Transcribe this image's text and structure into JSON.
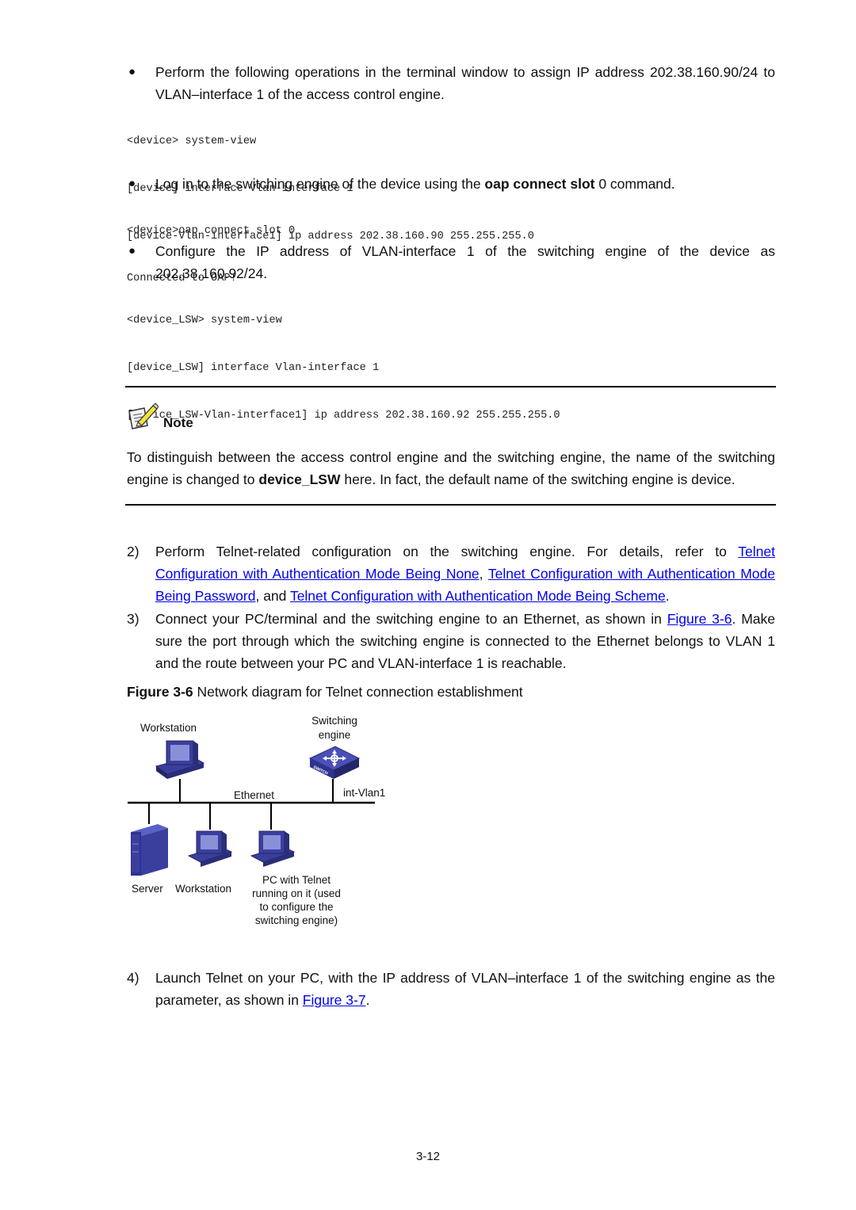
{
  "bullets": [
    {
      "text": "Perform the following operations in the terminal window to assign IP address 202.38.160.90/24 to VLAN–interface 1 of the access control engine."
    },
    {
      "text_before": "Log in to the switching engine of the device using the ",
      "bold": "oap connect slot",
      "text_after": " 0 command."
    },
    {
      "text": "Configure the IP address of VLAN-interface 1 of the switching engine of the device as 202.38.160.92/24."
    }
  ],
  "code_blocks": [
    [
      "<device> system-view",
      "[device] interface Vlan-interface 1",
      "[device-Vlan-interface1] ip address 202.38.160.90 255.255.255.0"
    ],
    [
      "<device>oap connect slot 0",
      "Connected to OAP!"
    ],
    [
      "<device_LSW> system-view",
      "[device_LSW] interface Vlan-interface 1",
      "[device_LSW-Vlan-interface1] ip address 202.38.160.92 255.255.255.0"
    ]
  ],
  "note": {
    "title": "Note",
    "text_before": "To distinguish between the access control engine and the switching engine, the name of the switching engine is changed to ",
    "bold": "device_LSW",
    "text_after": " here. In fact, the default name of the switching engine is device."
  },
  "steps": [
    {
      "number": "2)",
      "text_before": "Perform Telnet-related configuration on the switching engine. For details, refer to ",
      "link1": "Telnet Configuration with Authentication Mode Being None",
      "sep1": ", ",
      "link2": "Telnet Configuration with Authentication Mode Being Password",
      "sep2": ", and ",
      "link3": "Telnet Configuration with Authentication Mode Being Scheme",
      "text_after": "."
    },
    {
      "number": "3)",
      "text_before": "Connect your PC/terminal and the switching engine to an Ethernet, as shown in ",
      "link": "Figure 3-6",
      "text_after": ". Make sure the port through which the switching engine is connected to the Ethernet belongs to VLAN 1 and the route between your PC and VLAN-interface 1 is reachable."
    },
    {
      "number": "4)",
      "text_before": "Launch Telnet on your PC, with the IP address of VLAN–interface 1 of the switching engine as the parameter, as shown in ",
      "link": "Figure 3-7",
      "text_after": "."
    }
  ],
  "figure": {
    "caption_bold": "Figure 3-6",
    "caption_text": " Network diagram for Telnet connection establishment",
    "labels": {
      "workstation_top": "Workstation",
      "switch_line1": "Switching",
      "switch_line2": "engine",
      "ethernet": "Ethernet",
      "interface": "int-Vlan1",
      "server": "Server",
      "workstation_bottom": "Workstation",
      "pc_line1": "PC with Telnet",
      "pc_line2": "running on it (used",
      "pc_line3": "to configure the",
      "pc_line4": "switching engine)"
    },
    "switch_badge": "SWITCH"
  },
  "page_number": "3-12",
  "colors": {
    "link": "#0000ee",
    "device_blue": "#3a3f9e"
  }
}
